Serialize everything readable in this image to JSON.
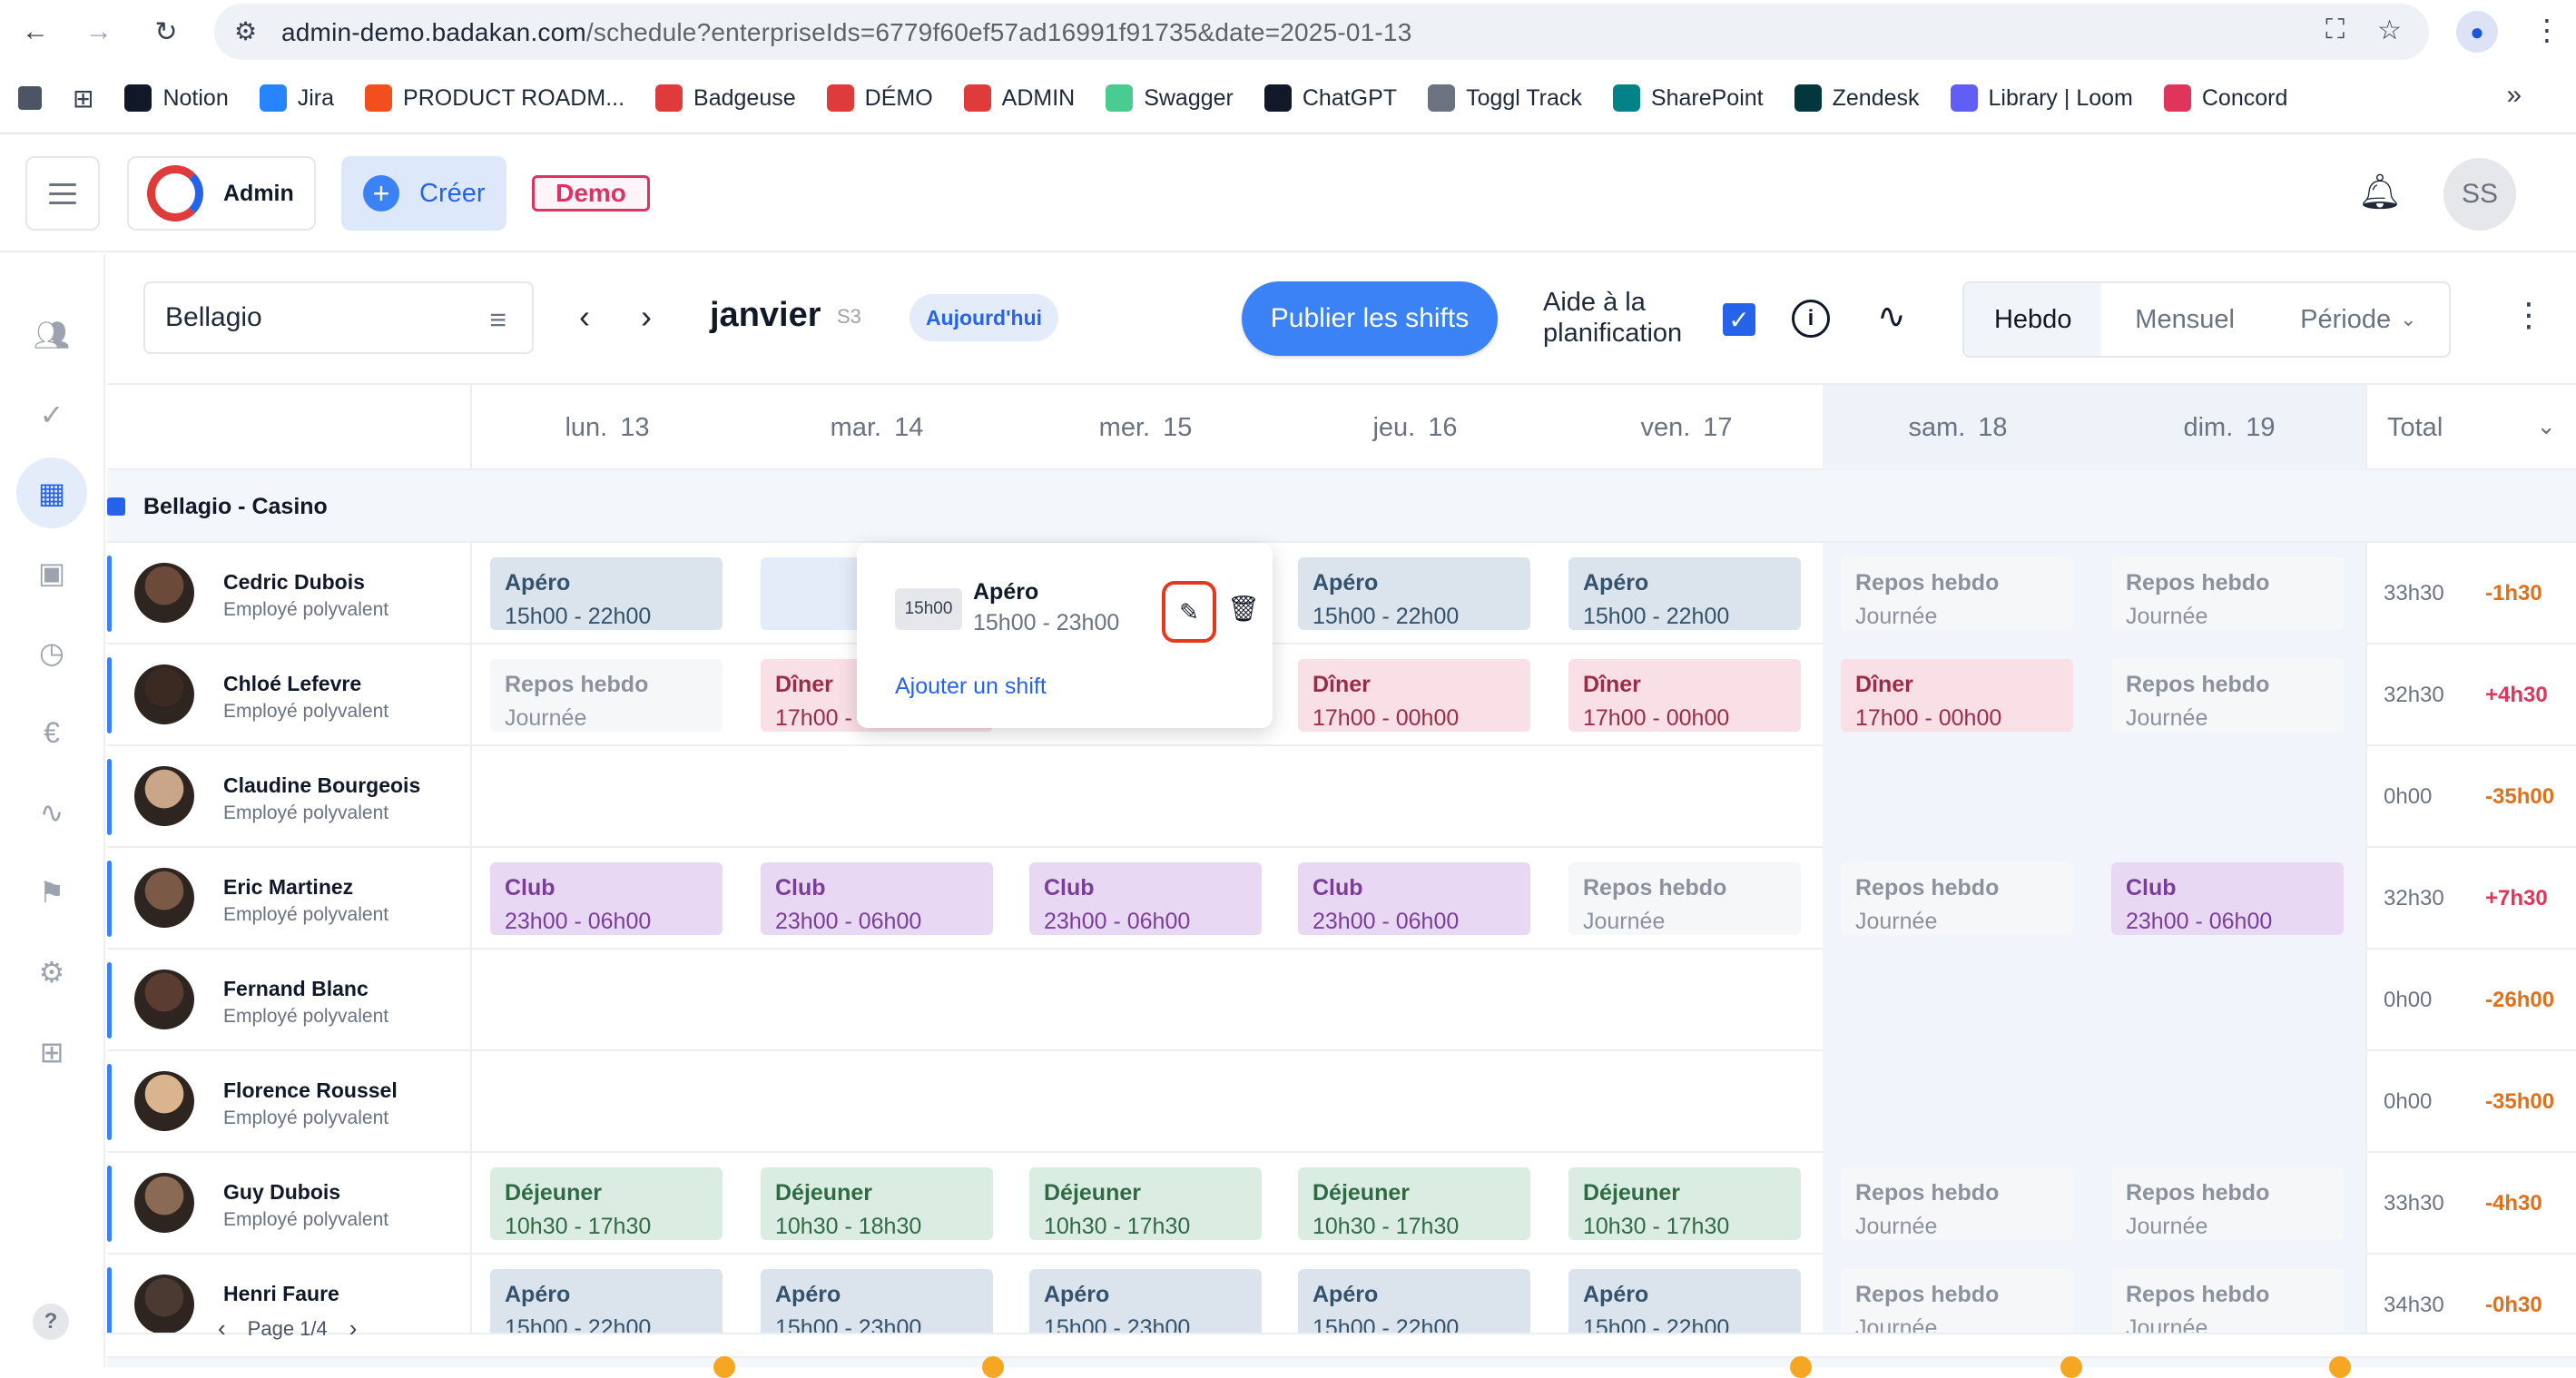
{
  "browser": {
    "url_host": "admin-demo.badakan.com",
    "url_path": "/schedule?enterpriseIds=6779f60ef57ad16991f91735&date=2025-01-13",
    "bookmarks": [
      {
        "label": "Notion",
        "color": "#111827"
      },
      {
        "label": "Jira",
        "color": "#2684ff"
      },
      {
        "label": "PRODUCT ROADM...",
        "color": "#f24e1e"
      },
      {
        "label": "Badgeuse",
        "color": "#e03b3b"
      },
      {
        "label": "DÉMO",
        "color": "#e03b3b"
      },
      {
        "label": "ADMIN",
        "color": "#e03b3b"
      },
      {
        "label": "Swagger",
        "color": "#49cc90"
      },
      {
        "label": "ChatGPT",
        "color": "#111827"
      },
      {
        "label": "Toggl Track",
        "color": "#6b7280"
      },
      {
        "label": "SharePoint",
        "color": "#038387"
      },
      {
        "label": "Zendesk",
        "color": "#03363d"
      },
      {
        "label": "Library | Loom",
        "color": "#625df5"
      },
      {
        "label": "Concord",
        "color": "#e0355a"
      }
    ]
  },
  "header": {
    "admin_label": "Admin",
    "create_label": "Créer",
    "demo_label": "Demo",
    "avatar_initials": "SS"
  },
  "toolbar": {
    "site": "Bellagio",
    "month": "janvier",
    "week": "S3",
    "today": "Aujourd'hui",
    "publish": "Publier les shifts",
    "aide_line1": "Aide à la",
    "aide_line2": "planification",
    "views": [
      "Hebdo",
      "Mensuel",
      "Période"
    ]
  },
  "days": [
    {
      "name": "lun.",
      "num": "13"
    },
    {
      "name": "mar.",
      "num": "14"
    },
    {
      "name": "mer.",
      "num": "15"
    },
    {
      "name": "jeu.",
      "num": "16"
    },
    {
      "name": "ven.",
      "num": "17"
    },
    {
      "name": "sam.",
      "num": "18"
    },
    {
      "name": "dim.",
      "num": "19"
    }
  ],
  "total_label": "Total",
  "group": "Bellagio - Casino",
  "employees": [
    {
      "name": "Cedric Dubois",
      "role": "Employé polyvalent",
      "total": "33h30",
      "delta": "-1h30"
    },
    {
      "name": "Chloé Lefevre",
      "role": "Employé polyvalent",
      "total": "32h30",
      "delta": "+4h30"
    },
    {
      "name": "Claudine Bourgeois",
      "role": "Employé polyvalent",
      "total": "0h00",
      "delta": "-35h00"
    },
    {
      "name": "Eric Martinez",
      "role": "Employé polyvalent",
      "total": "32h30",
      "delta": "+7h30"
    },
    {
      "name": "Fernand Blanc",
      "role": "Employé polyvalent",
      "total": "0h00",
      "delta": "-26h00"
    },
    {
      "name": "Florence Roussel",
      "role": "Employé polyvalent",
      "total": "0h00",
      "delta": "-35h00"
    },
    {
      "name": "Guy Dubois",
      "role": "Employé polyvalent",
      "total": "33h30",
      "delta": "-4h30"
    },
    {
      "name": "Henri Faure",
      "role": "",
      "total": "34h30",
      "delta": "-0h30"
    }
  ],
  "shift_labels": {
    "apero": "Apéro",
    "diner": "Dîner",
    "club": "Club",
    "dejeuner": "Déjeuner",
    "repos": "Repos hebdo",
    "journee": "Journée",
    "t_15_22": "15h00 - 22h00",
    "t_15_23": "15h00 - 23h00",
    "t_17_00": "17h00 - 00h00",
    "t_17_trunc": "17h00 -",
    "t_23_06": "23h00 - 06h00",
    "t_1030_1730": "10h30 - 17h30",
    "t_1030_1830": "10h30 - 18h30"
  },
  "popover": {
    "tag": "15h00",
    "title": "Apéro",
    "time": "15h00 - 23h00",
    "add_link": "Ajouter un shift"
  },
  "pager": "Page 1/4"
}
